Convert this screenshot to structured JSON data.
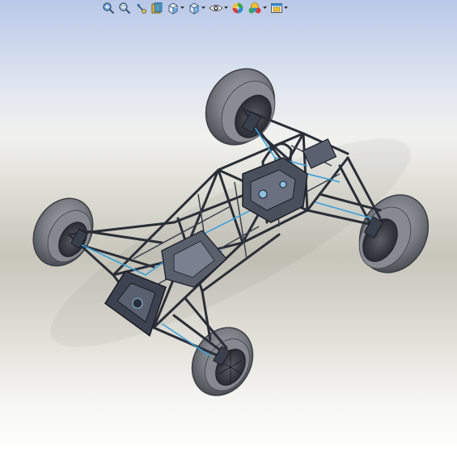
{
  "app": {
    "toolbar": {
      "tools": [
        {
          "name": "zoom-to-fit-icon",
          "has_dropdown": false
        },
        {
          "name": "zoom-to-area-icon",
          "has_dropdown": false
        },
        {
          "name": "previous-view-icon",
          "has_dropdown": false
        },
        {
          "name": "section-view-icon",
          "has_dropdown": false
        },
        {
          "name": "view-orientation-icon",
          "has_dropdown": true
        },
        {
          "name": "display-style-icon",
          "has_dropdown": true
        },
        {
          "name": "hide-show-items-icon",
          "has_dropdown": true
        },
        {
          "name": "edit-appearance-icon",
          "has_dropdown": true
        },
        {
          "name": "apply-scene-icon",
          "has_dropdown": true
        },
        {
          "name": "view-settings-icon",
          "has_dropdown": true
        }
      ]
    },
    "colors": {
      "accent": "#2f8fd6",
      "frame": "#2a2e38",
      "tire": "#6e7078",
      "tire_edge": "#3c3e44",
      "blue_line": "#3aa0d8"
    }
  }
}
